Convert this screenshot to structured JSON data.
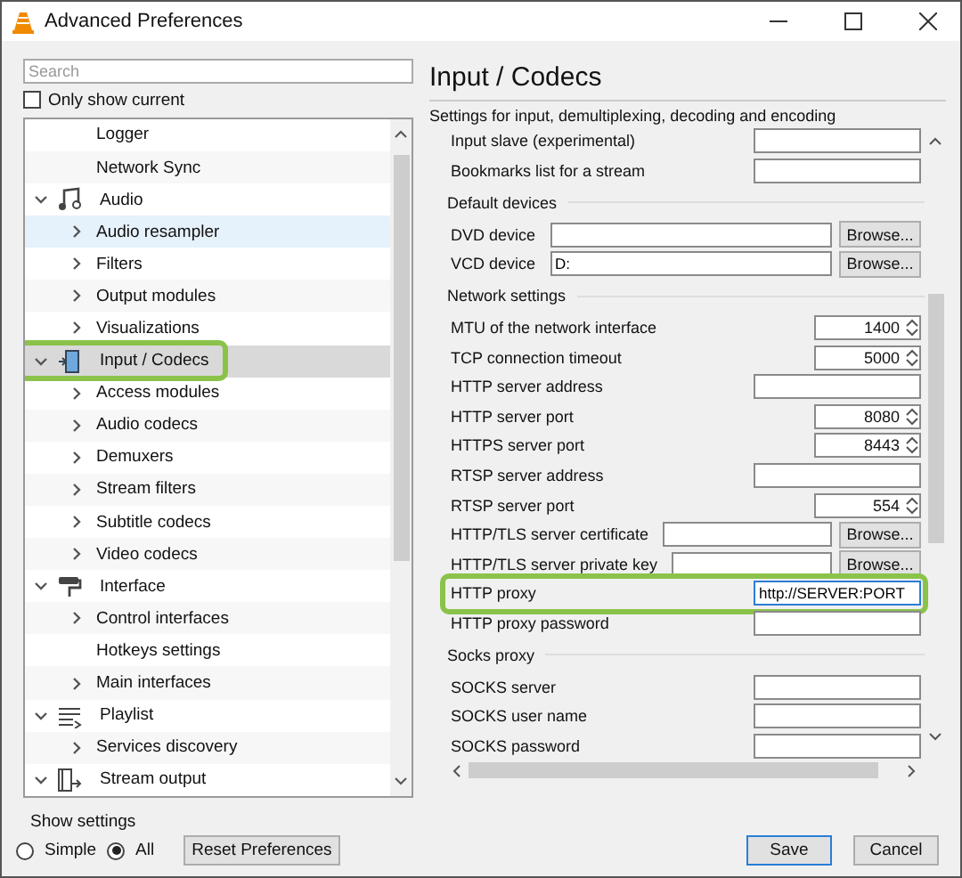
{
  "window": {
    "title": "Advanced Preferences"
  },
  "search": {
    "placeholder": "Search"
  },
  "only_show_current": {
    "label": "Only show current",
    "checked": false
  },
  "tree": {
    "partial_items": [
      {
        "label": "Logger",
        "expandable": false,
        "selected": false,
        "hovered": false
      },
      {
        "label": "Network Sync",
        "expandable": false,
        "selected": false,
        "hovered": false
      }
    ],
    "categories": [
      {
        "label": "Audio",
        "kind": "music",
        "expanded": true,
        "selected": false,
        "highlighted": false,
        "children": [
          {
            "label": "Audio resampler",
            "expandable": true,
            "selected": false,
            "hovered": true
          },
          {
            "label": "Filters",
            "expandable": true,
            "selected": false,
            "hovered": false
          },
          {
            "label": "Output modules",
            "expandable": true,
            "selected": false,
            "hovered": false
          },
          {
            "label": "Visualizations",
            "expandable": true,
            "selected": false,
            "hovered": false
          }
        ]
      },
      {
        "label": "Input / Codecs",
        "kind": "codec",
        "expanded": true,
        "selected": true,
        "highlighted": true,
        "children": [
          {
            "label": "Access modules",
            "expandable": true,
            "selected": false,
            "hovered": false
          },
          {
            "label": "Audio codecs",
            "expandable": true,
            "selected": false,
            "hovered": false
          },
          {
            "label": "Demuxers",
            "expandable": true,
            "selected": false,
            "hovered": false
          },
          {
            "label": "Stream filters",
            "expandable": true,
            "selected": false,
            "hovered": false
          },
          {
            "label": "Subtitle codecs",
            "expandable": true,
            "selected": false,
            "hovered": false
          },
          {
            "label": "Video codecs",
            "expandable": true,
            "selected": false,
            "hovered": false
          }
        ]
      },
      {
        "label": "Interface",
        "kind": "roller",
        "expanded": true,
        "selected": false,
        "highlighted": false,
        "children": [
          {
            "label": "Control interfaces",
            "expandable": true,
            "selected": false,
            "hovered": false
          },
          {
            "label": "Hotkeys settings",
            "expandable": false,
            "selected": false,
            "hovered": false
          },
          {
            "label": "Main interfaces",
            "expandable": true,
            "selected": false,
            "hovered": false
          }
        ]
      },
      {
        "label": "Playlist",
        "kind": "playlist",
        "expanded": true,
        "selected": false,
        "highlighted": false,
        "children": [
          {
            "label": "Services discovery",
            "expandable": true,
            "selected": false,
            "hovered": false
          }
        ]
      },
      {
        "label": "Stream output",
        "kind": "stream",
        "expanded": true,
        "selected": false,
        "highlighted": false
      }
    ]
  },
  "show_settings": {
    "label": "Show settings",
    "options": [
      {
        "label": "Simple",
        "selected": false
      },
      {
        "label": "All",
        "selected": true
      }
    ]
  },
  "reset_button": "Reset Preferences",
  "panel": {
    "title": "Input / Codecs",
    "subtitle": "Settings for input, demultiplexing, decoding and encoding",
    "rows": [
      {
        "kind": "text",
        "label": "Input slave (experimental)"
      },
      {
        "kind": "text",
        "label": "Bookmarks list for a stream"
      },
      {
        "kind": "section",
        "label": "Default devices"
      },
      {
        "kind": "browse",
        "label": "DVD device",
        "button": "Browse..."
      },
      {
        "kind": "browse",
        "label": "VCD device",
        "value": "D:",
        "button": "Browse..."
      },
      {
        "kind": "section",
        "label": "Network settings"
      },
      {
        "kind": "spin",
        "label": "MTU of the network interface",
        "value": "1400"
      },
      {
        "kind": "spin",
        "label": "TCP connection timeout",
        "value": "5000"
      },
      {
        "kind": "text",
        "label": "HTTP server address"
      },
      {
        "kind": "spin",
        "label": "HTTP server port",
        "value": "8080"
      },
      {
        "kind": "spin",
        "label": "HTTPS server port",
        "value": "8443"
      },
      {
        "kind": "text",
        "label": "RTSP server address"
      },
      {
        "kind": "spin",
        "label": "RTSP server port",
        "value": "554"
      },
      {
        "kind": "browse",
        "label": "HTTP/TLS server certificate",
        "button": "Browse..."
      },
      {
        "kind": "browse",
        "label": "HTTP/TLS server private key",
        "button": "Browse..."
      },
      {
        "kind": "text",
        "label": "HTTP proxy",
        "value": "http://SERVER:PORT",
        "highlighted": true,
        "focused": true
      },
      {
        "kind": "text",
        "label": "HTTP proxy password"
      },
      {
        "kind": "section",
        "label": "Socks proxy"
      },
      {
        "kind": "text",
        "label": "SOCKS server"
      },
      {
        "kind": "text",
        "label": "SOCKS user name"
      },
      {
        "kind": "text",
        "label": "SOCKS password"
      }
    ]
  },
  "buttons": [
    {
      "label": "Save",
      "default": true
    },
    {
      "label": "Cancel",
      "default": false
    }
  ]
}
